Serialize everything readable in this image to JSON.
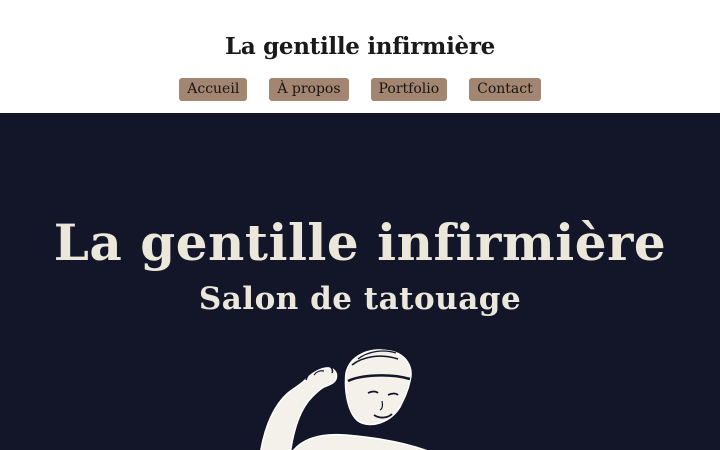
{
  "header": {
    "site_title": "La gentille infirmière",
    "nav": [
      {
        "label": "Accueil"
      },
      {
        "label": "À propos"
      },
      {
        "label": "Portfolio"
      },
      {
        "label": "Contact"
      }
    ]
  },
  "hero": {
    "title": "La gentille infirmière",
    "subtitle": "Salon de tatouage",
    "illustration_icon": "pinup-woman-flexing-illustration"
  },
  "colors": {
    "nav_button_bg": "#a38672",
    "hero_bg": "#131629",
    "hero_text": "#ebe7da"
  }
}
